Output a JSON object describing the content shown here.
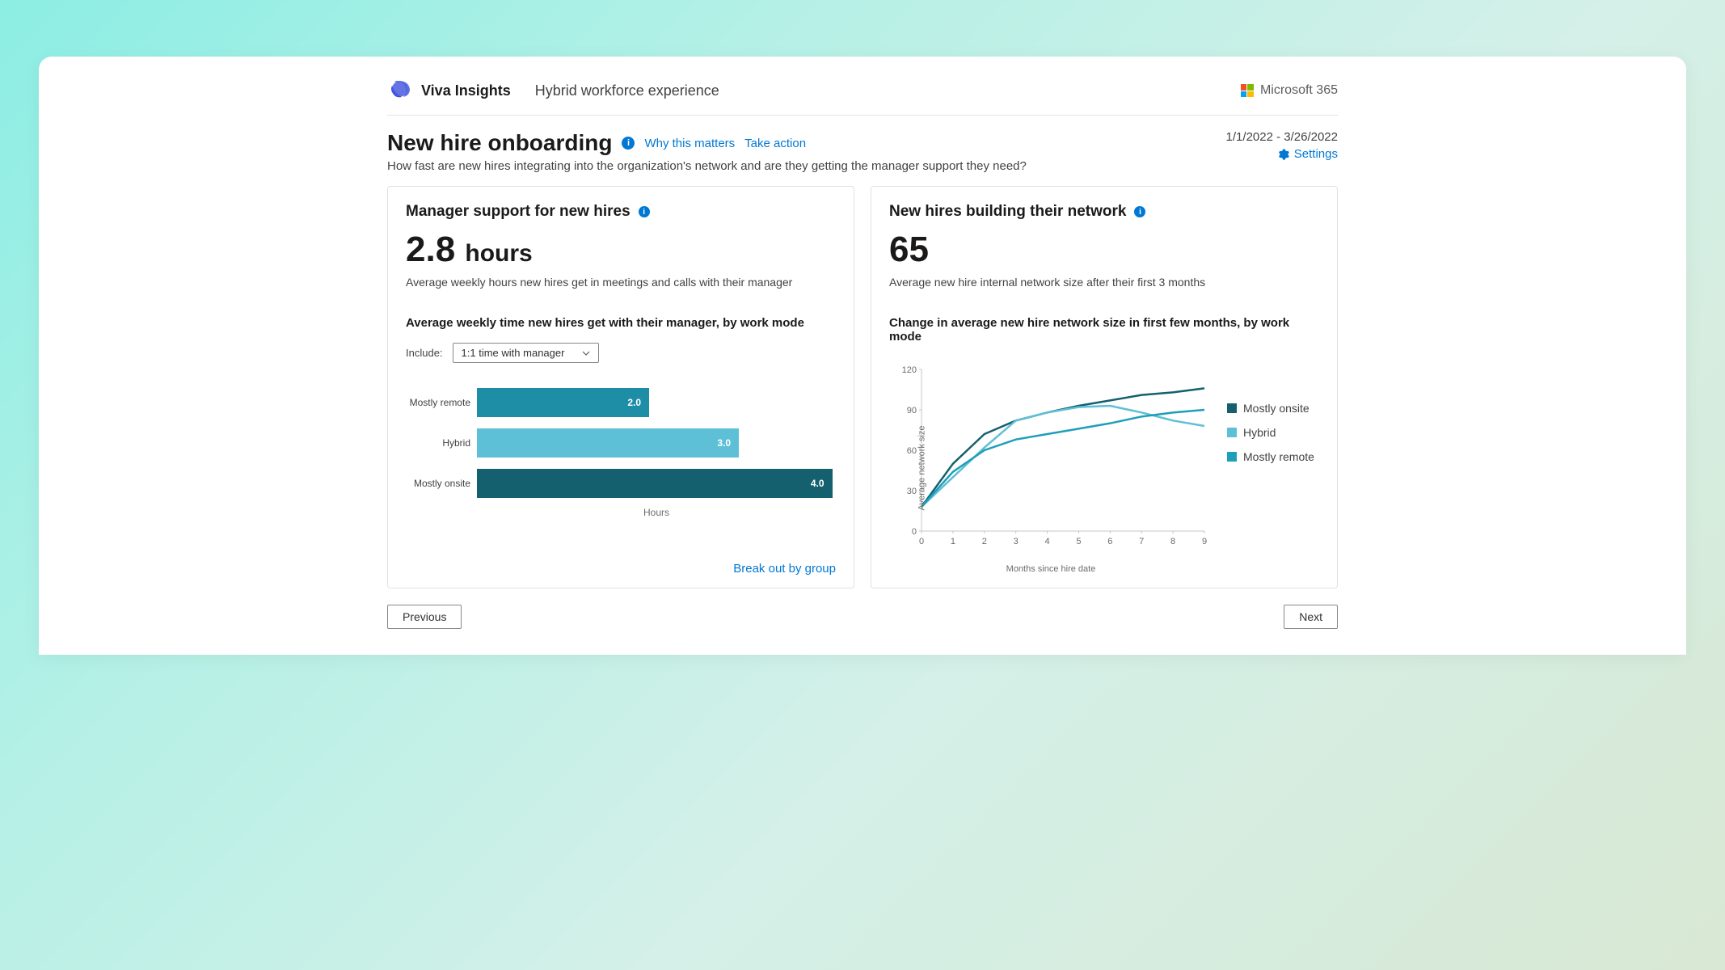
{
  "header": {
    "app_name": "Viva Insights",
    "subtitle": "Hybrid workforce experience",
    "ms365": "Microsoft 365"
  },
  "page": {
    "title": "New hire onboarding",
    "why_link": "Why this matters",
    "action_link": "Take action",
    "description": "How fast are new hires integrating into the organization's network and are they getting the manager support they need?",
    "date_range": "1/1/2022 - 3/26/2022",
    "settings": "Settings"
  },
  "card_left": {
    "title": "Manager support for new hires",
    "stat_value": "2.8",
    "stat_unit": "hours",
    "stat_desc": "Average weekly hours new hires get in meetings and calls with their manager",
    "chart_title": "Average weekly time new hires get with their manager, by work mode",
    "filter_label": "Include:",
    "filter_value": "1:1 time with manager",
    "axis_label": "Hours",
    "break_link": "Break out by group",
    "bars": {
      "remote_label": "Mostly remote",
      "remote_value": "2.0",
      "hybrid_label": "Hybrid",
      "hybrid_value": "3.0",
      "onsite_label": "Mostly onsite",
      "onsite_value": "4.0"
    }
  },
  "card_right": {
    "title": "New hires building their network",
    "stat_value": "65",
    "stat_desc": "Average new hire internal network size after their first 3 months",
    "chart_title": "Change in average new hire network size in first few months, by work mode",
    "y_label": "Average network size",
    "x_label": "Months since hire date",
    "legend": {
      "onsite": "Mostly onsite",
      "hybrid": "Hybrid",
      "remote": "Mostly remote"
    }
  },
  "nav": {
    "prev": "Previous",
    "next": "Next"
  },
  "chart_data": [
    {
      "type": "bar",
      "title": "Average weekly time new hires get with their manager, by work mode",
      "xlabel": "Hours",
      "ylabel": "",
      "categories": [
        "Mostly remote",
        "Hybrid",
        "Mostly onsite"
      ],
      "values": [
        2.0,
        3.0,
        4.0
      ],
      "xlim": [
        0,
        4
      ]
    },
    {
      "type": "line",
      "title": "Change in average new hire network size in first few months, by work mode",
      "xlabel": "Months since hire date",
      "ylabel": "Average network size",
      "x": [
        0,
        1,
        2,
        3,
        4,
        5,
        6,
        7,
        8,
        9
      ],
      "series": [
        {
          "name": "Mostly onsite",
          "color": "#14606e",
          "values": [
            18,
            50,
            72,
            82,
            88,
            93,
            97,
            101,
            103,
            106,
            108
          ]
        },
        {
          "name": "Hybrid",
          "color": "#5ec0d6",
          "values": [
            18,
            40,
            62,
            82,
            88,
            92,
            93,
            88,
            82,
            78,
            74
          ]
        },
        {
          "name": "Mostly remote",
          "color": "#1e9fb8",
          "values": [
            18,
            44,
            60,
            68,
            72,
            76,
            80,
            85,
            88,
            90,
            90
          ]
        }
      ],
      "ylim": [
        0,
        120
      ],
      "xlim": [
        0,
        9
      ]
    }
  ]
}
